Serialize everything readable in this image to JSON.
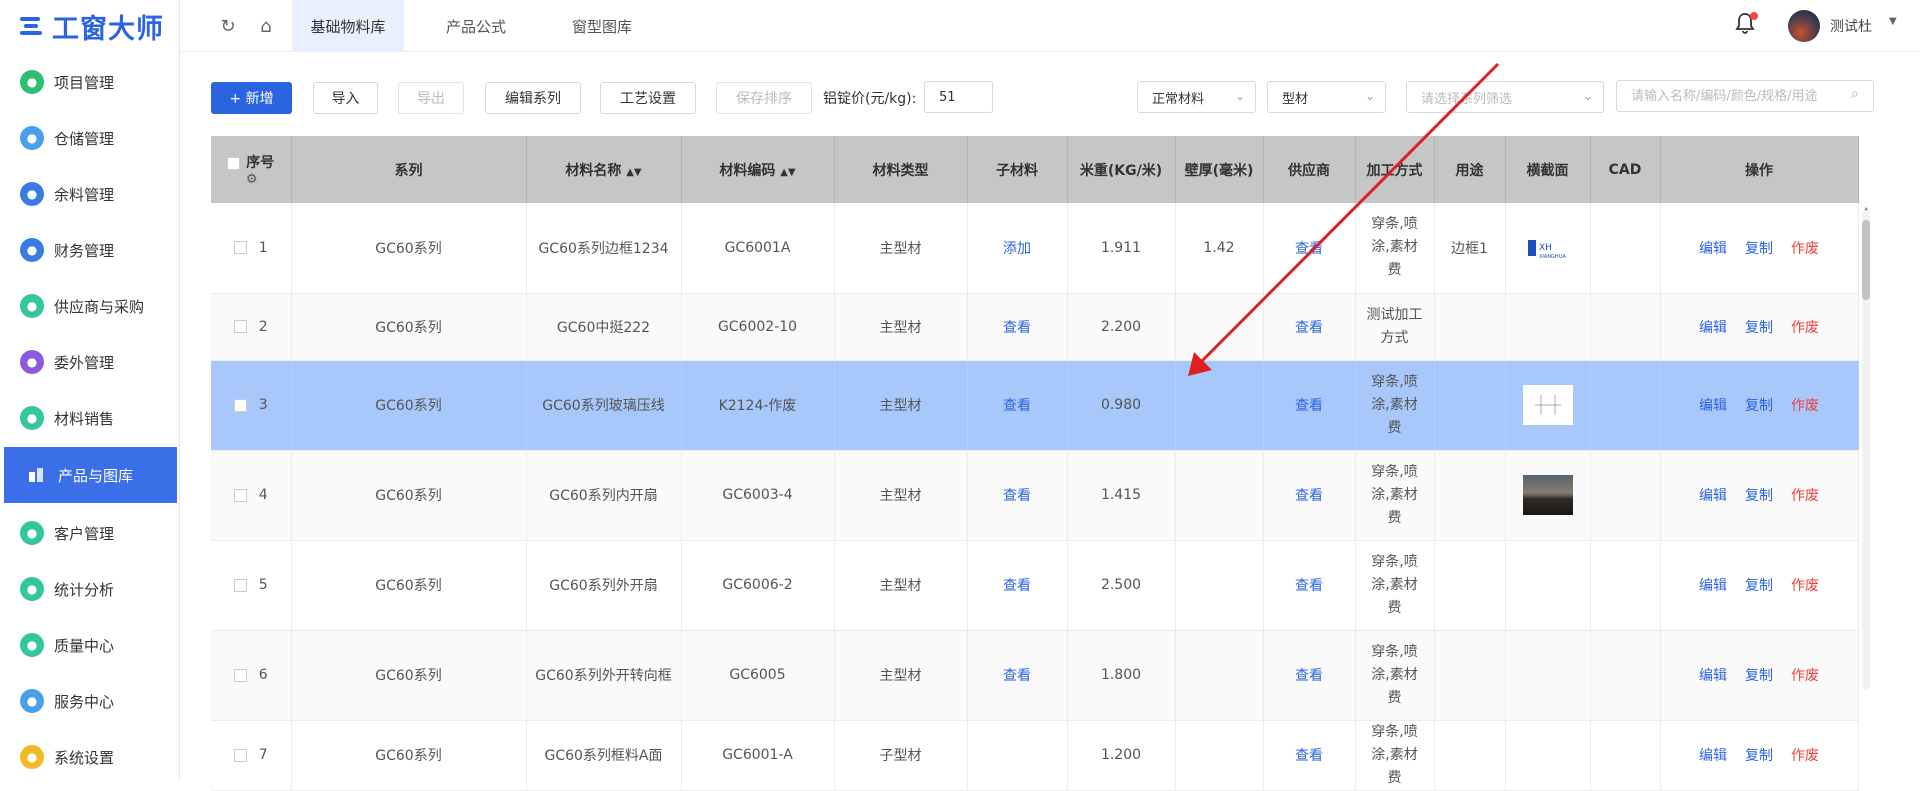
{
  "logo": {
    "text": "工窗大师",
    "color": "#2b64e0"
  },
  "sidebar": {
    "items": [
      {
        "label": "项目管理",
        "icon": "project-icon",
        "color": "#2fbf71"
      },
      {
        "label": "仓储管理",
        "icon": "warehouse-icon",
        "color": "#4aa0e8"
      },
      {
        "label": "余料管理",
        "icon": "leftover-icon",
        "color": "#3a7de0"
      },
      {
        "label": "财务管理",
        "icon": "finance-icon",
        "color": "#3a7de0"
      },
      {
        "label": "供应商与采购",
        "icon": "supplier-icon",
        "color": "#35c6a0"
      },
      {
        "label": "委外管理",
        "icon": "outsource-icon",
        "color": "#8e58e0"
      },
      {
        "label": "材料销售",
        "icon": "sales-icon",
        "color": "#35c6a0"
      },
      {
        "label": "产品与图库",
        "icon": "product-icon",
        "color": "#3a6fe8",
        "active": true
      },
      {
        "label": "客户管理",
        "icon": "customer-icon",
        "color": "#35c6a0"
      },
      {
        "label": "统计分析",
        "icon": "stats-icon",
        "color": "#35c6a0"
      },
      {
        "label": "质量中心",
        "icon": "quality-icon",
        "color": "#35c6a0"
      },
      {
        "label": "服务中心",
        "icon": "service-icon",
        "color": "#4aa0e8"
      },
      {
        "label": "系统设置",
        "icon": "settings-icon",
        "color": "#f2b826"
      }
    ]
  },
  "header": {
    "tabs": [
      {
        "label": "基础物料库",
        "active": true
      },
      {
        "label": "产品公式"
      },
      {
        "label": "窗型图库"
      }
    ],
    "user": "测试杜"
  },
  "toolbar": {
    "add_label": "+ 新增",
    "import_label": "导入",
    "export_label": "导出",
    "edit_series_label": "编辑系列",
    "process_label": "工艺设置",
    "save_order_label": "保存排序",
    "price_label": "铝锭价(元/kg):",
    "price_value": "51",
    "filter_material": "正常材料",
    "filter_type": "型材",
    "filter_series_placeholder": "请选择系列筛选",
    "search_placeholder": "请输入名称/编码/颜色/规格/用途"
  },
  "table": {
    "headers": [
      "序号",
      "系列",
      "材料名称",
      "材料编码",
      "材料类型",
      "子材料",
      "米重(KG/米)",
      "壁厚(毫米)",
      "供应商",
      "加工方式",
      "用途",
      "横截面",
      "CAD",
      "操作"
    ],
    "actions": [
      "编辑",
      "复制",
      "作废"
    ],
    "rows": [
      {
        "no": "1",
        "series": "GC60系列",
        "name": "GC60系列边框1234",
        "code": "GC6001A",
        "type": "主型材",
        "sub": "添加",
        "weight": "1.911",
        "wall": "1.42",
        "supplier": "查看",
        "process": "穿条,喷涂,素材费",
        "use": "边框1",
        "thumb": "logo"
      },
      {
        "no": "2",
        "series": "GC60系列",
        "name": "GC60中挺222",
        "code": "GC6002-10",
        "type": "主型材",
        "sub": "查看",
        "weight": "2.200",
        "wall": "",
        "supplier": "查看",
        "process": "测试加工方式",
        "use": "",
        "thumb": ""
      },
      {
        "no": "3",
        "series": "GC60系列",
        "name": "GC60系列玻璃压线",
        "code": "K2124-作废",
        "type": "主型材",
        "sub": "查看",
        "weight": "0.980",
        "wall": "",
        "supplier": "查看",
        "process": "穿条,喷涂,素材费",
        "use": "",
        "thumb": "drawing",
        "selected": true
      },
      {
        "no": "4",
        "series": "GC60系列",
        "name": "GC60系列内开扇",
        "code": "GC6003-4",
        "type": "主型材",
        "sub": "查看",
        "weight": "1.415",
        "wall": "",
        "supplier": "查看",
        "process": "穿条,喷涂,素材费",
        "use": "",
        "thumb": "photo"
      },
      {
        "no": "5",
        "series": "GC60系列",
        "name": "GC60系列外开扇",
        "code": "GC6006-2",
        "type": "主型材",
        "sub": "查看",
        "weight": "2.500",
        "wall": "",
        "supplier": "查看",
        "process": "穿条,喷涂,素材费",
        "use": "",
        "thumb": ""
      },
      {
        "no": "6",
        "series": "GC60系列",
        "name": "GC60系列外开转向框",
        "code": "GC6005",
        "type": "主型材",
        "sub": "查看",
        "weight": "1.800",
        "wall": "",
        "supplier": "查看",
        "process": "穿条,喷涂,素材费",
        "use": "",
        "thumb": ""
      },
      {
        "no": "7",
        "series": "GC60系列",
        "name": "GC60系列框料A面",
        "code": "GC6001-A",
        "type": "子型材",
        "sub": "",
        "weight": "1.200",
        "wall": "",
        "supplier": "查看",
        "process": "穿条,喷涂,素材费",
        "use": "",
        "thumb": ""
      }
    ]
  },
  "colors": {
    "accent": "#2b64e0",
    "selected_row": "#a8c7fa",
    "header_bg": "#c6c6c6",
    "danger": "#f04040",
    "annotation_arrow": "#e02020"
  }
}
